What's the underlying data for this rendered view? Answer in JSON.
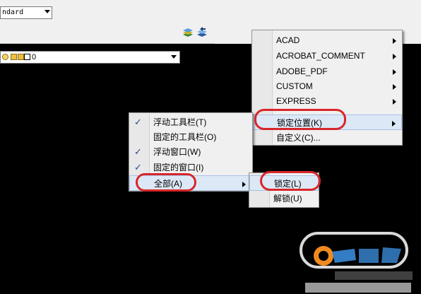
{
  "toolbar": {
    "style_combo": "ndard",
    "layer_combo_value": "0"
  },
  "menu_main": {
    "items": [
      {
        "label": "ACAD",
        "submenu": true
      },
      {
        "label": "ACROBAT_COMMENT",
        "submenu": true
      },
      {
        "label": "ADOBE_PDF",
        "submenu": true
      },
      {
        "label": "CUSTOM",
        "submenu": true
      },
      {
        "label": "EXPRESS",
        "submenu": true
      },
      {
        "label": "锁定位置(K)",
        "submenu": true,
        "highlighted": true
      },
      {
        "label": "自定义(C)...",
        "submenu": false
      }
    ]
  },
  "menu_lock": {
    "items": [
      {
        "label": "浮动工具栏(T)",
        "checked": true
      },
      {
        "label": "固定的工具栏(O)",
        "checked": false
      },
      {
        "label": "浮动窗口(W)",
        "checked": true
      },
      {
        "label": "固定的窗口(I)",
        "checked": true
      },
      {
        "label": "全部(A)",
        "submenu": true,
        "highlighted": true
      }
    ]
  },
  "menu_all": {
    "items": [
      {
        "label": "锁定(L)",
        "highlighted": true
      },
      {
        "label": "解锁(U)"
      }
    ]
  },
  "colors": {
    "canvas": "#000000",
    "menu_bg": "#f0f0f0",
    "highlight": "#dde8f6",
    "annotation": "#d8262a"
  }
}
